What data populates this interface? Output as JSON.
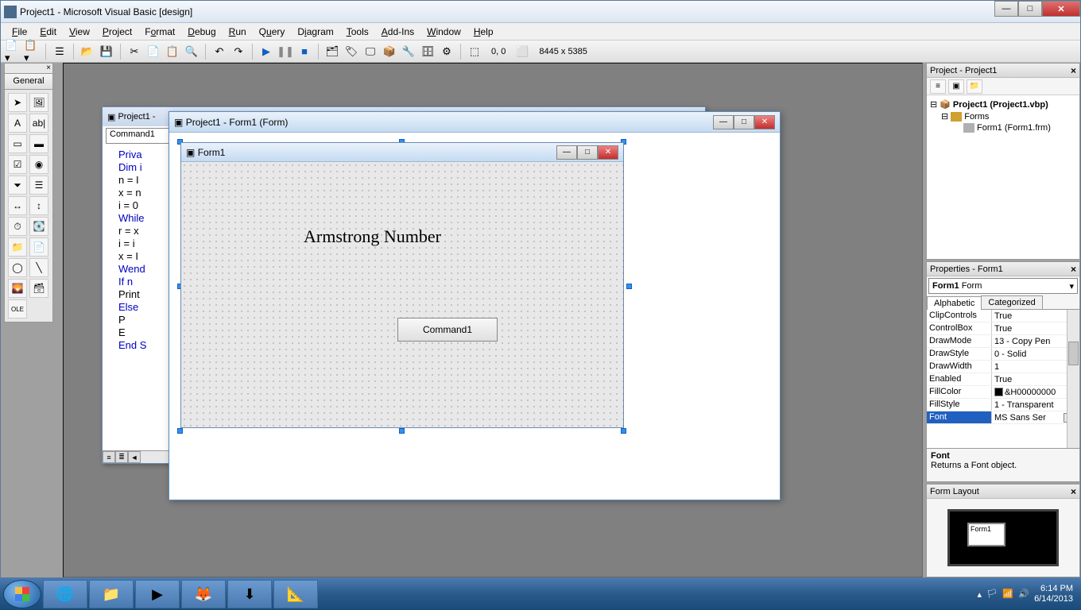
{
  "titlebar": {
    "title": "Project1 - Microsoft Visual Basic [design]"
  },
  "menubar": {
    "items": [
      "File",
      "Edit",
      "View",
      "Project",
      "Format",
      "Debug",
      "Run",
      "Query",
      "Diagram",
      "Tools",
      "Add-Ins",
      "Window",
      "Help"
    ]
  },
  "toolbar": {
    "coords": "0, 0",
    "size": "8445 x 5385"
  },
  "toolbox": {
    "title": "General"
  },
  "code_window": {
    "title": "Project1 -",
    "combo": "Command1",
    "lines": [
      "Priva",
      "Dim i",
      "n = I",
      "x = n",
      "i = 0",
      "While",
      "r = x",
      "i = i",
      "x = I",
      "Wend",
      "If n",
      "Print",
      "Else",
      "   P",
      "   E",
      "End S"
    ],
    "kw_idx": [
      0,
      1,
      5,
      9,
      10,
      12,
      15
    ]
  },
  "form_design_window": {
    "title": "Project1 - Form1 (Form)"
  },
  "designed_form": {
    "title": "Form1",
    "label_text": "Armstrong Number",
    "button_text": "Command1"
  },
  "project_panel": {
    "title": "Project - Project1",
    "root": "Project1 (Project1.vbp)",
    "folder": "Forms",
    "form": "Form1 (Form1.frm)"
  },
  "properties_panel": {
    "title": "Properties - Form1",
    "object": "Form1",
    "object_type": "Form",
    "tabs": [
      "Alphabetic",
      "Categorized"
    ],
    "rows": [
      {
        "name": "ClipControls",
        "value": "True"
      },
      {
        "name": "ControlBox",
        "value": "True"
      },
      {
        "name": "DrawMode",
        "value": "13 - Copy Pen"
      },
      {
        "name": "DrawStyle",
        "value": "0 - Solid"
      },
      {
        "name": "DrawWidth",
        "value": "1"
      },
      {
        "name": "Enabled",
        "value": "True"
      },
      {
        "name": "FillColor",
        "value": "&H00000000"
      },
      {
        "name": "FillStyle",
        "value": "1 - Transparent"
      },
      {
        "name": "Font",
        "value": "MS Sans Ser",
        "selected": true
      }
    ],
    "desc_title": "Font",
    "desc_body": "Returns a Font object."
  },
  "form_layout_panel": {
    "title": "Form Layout",
    "form_label": "Form1"
  },
  "taskbar": {
    "time": "6:14 PM",
    "date": "6/14/2013"
  }
}
